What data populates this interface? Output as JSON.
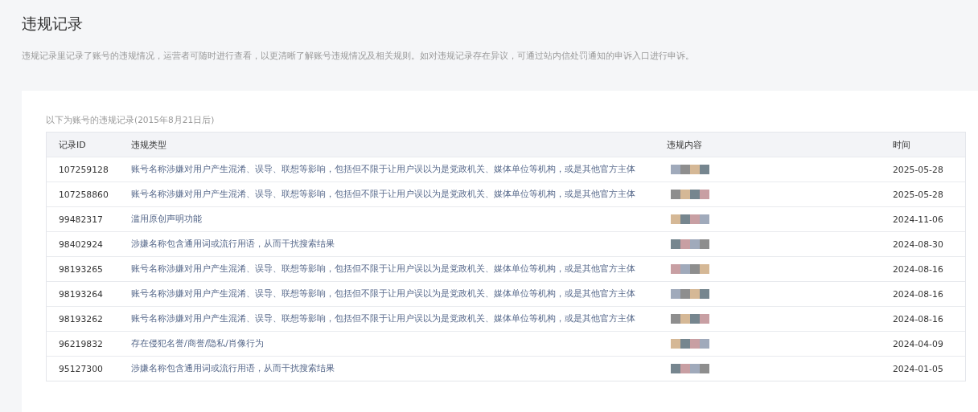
{
  "page": {
    "title": "违规记录",
    "description": "违规记录里记录了账号的违规情况，运营者可随时进行查看，以更清晰了解账号违规情况及相关规则。如对违规记录存在异议，可通过站内信处罚通知的申诉入口进行申诉。"
  },
  "table": {
    "caption": "以下为账号的违规记录(2015年8月21日后)",
    "columns": [
      "记录ID",
      "违规类型",
      "违规内容",
      "时间"
    ],
    "rows": [
      {
        "id": "107259128",
        "type": "账号名称涉嫌对用户产生混淆、误导、联想等影响，包括但不限于让用户误以为是党政机关、媒体单位等机构，或是其他官方主体",
        "time": "2025-05-28"
      },
      {
        "id": "107258860",
        "type": "账号名称涉嫌对用户产生混淆、误导、联想等影响，包括但不限于让用户误以为是党政机关、媒体单位等机构，或是其他官方主体",
        "time": "2025-05-28"
      },
      {
        "id": "99482317",
        "type": "滥用原创声明功能",
        "time": "2024-11-06"
      },
      {
        "id": "98402924",
        "type": "涉嫌名称包含通用词或流行用语，从而干扰搜索结果",
        "time": "2024-08-30"
      },
      {
        "id": "98193265",
        "type": "账号名称涉嫌对用户产生混淆、误导、联想等影响，包括但不限于让用户误以为是党政机关、媒体单位等机构，或是其他官方主体",
        "time": "2024-08-16"
      },
      {
        "id": "98193264",
        "type": "账号名称涉嫌对用户产生混淆、误导、联想等影响，包括但不限于让用户误以为是党政机关、媒体单位等机构，或是其他官方主体",
        "time": "2024-08-16"
      },
      {
        "id": "98193262",
        "type": "账号名称涉嫌对用户产生混淆、误导、联想等影响，包括但不限于让用户误以为是党政机关、媒体单位等机构，或是其他官方主体",
        "time": "2024-08-16"
      },
      {
        "id": "96219832",
        "type": "存在侵犯名誉/商誉/隐私/肖像行为",
        "time": "2024-04-09"
      },
      {
        "id": "95127300",
        "type": "涉嫌名称包含通用词或流行用语，从而干扰搜索结果",
        "time": "2024-01-05"
      }
    ]
  }
}
